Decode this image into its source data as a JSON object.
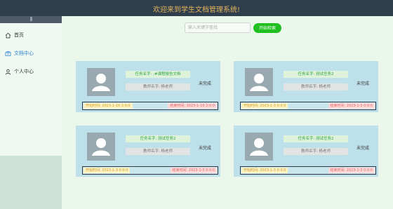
{
  "header": {
    "title": "欢迎来到学生文档管理系统!"
  },
  "sidebar": {
    "collapse_label": "|||",
    "items": [
      {
        "label": "首页",
        "icon": "home-icon",
        "active": false
      },
      {
        "label": "文档中心",
        "icon": "folder-icon",
        "active": true
      },
      {
        "label": "个人中心",
        "icon": "user-icon",
        "active": false
      }
    ]
  },
  "search": {
    "placeholder": "输入关键字查找",
    "button_label": "开始检索"
  },
  "cards": [
    {
      "task": "任务名字: ;#课程报告文档",
      "teacher": "教师名字: 杨老师",
      "status": "未完成",
      "start": "开始时间: 2023-1-10 2:0:0",
      "end": "结束时间: 2023-1-10 2:0:0"
    },
    {
      "task": "任务名字: 测试任务2",
      "teacher": "教师名字: 杨老师",
      "status": "未完成",
      "start": "开始时间: 2023-1-3 0:0:0",
      "end": "结束时间: 2023-1-3 0:0:0"
    },
    {
      "task": "任务名字: 测试任务2",
      "teacher": "教师名字: 杨老师",
      "status": "未完成",
      "start": "开始时间: 2023-1-3 0:0:0",
      "end": "结束时间: 2023-1-3 0:0:0"
    },
    {
      "task": "任务名字: 测试任务2",
      "teacher": "教师名字: 杨老师",
      "status": "未完成",
      "start": "开始时间: 2023-1-3 0:0:0",
      "end": "结束时间: 2023-1-3 0:0:0"
    }
  ],
  "colors": {
    "header_bg": "#2f3e4c",
    "title": "#e3b35c",
    "accent": "#1fbf1f",
    "active_menu": "#2b83d6",
    "card_bg": "#bde0ea"
  }
}
